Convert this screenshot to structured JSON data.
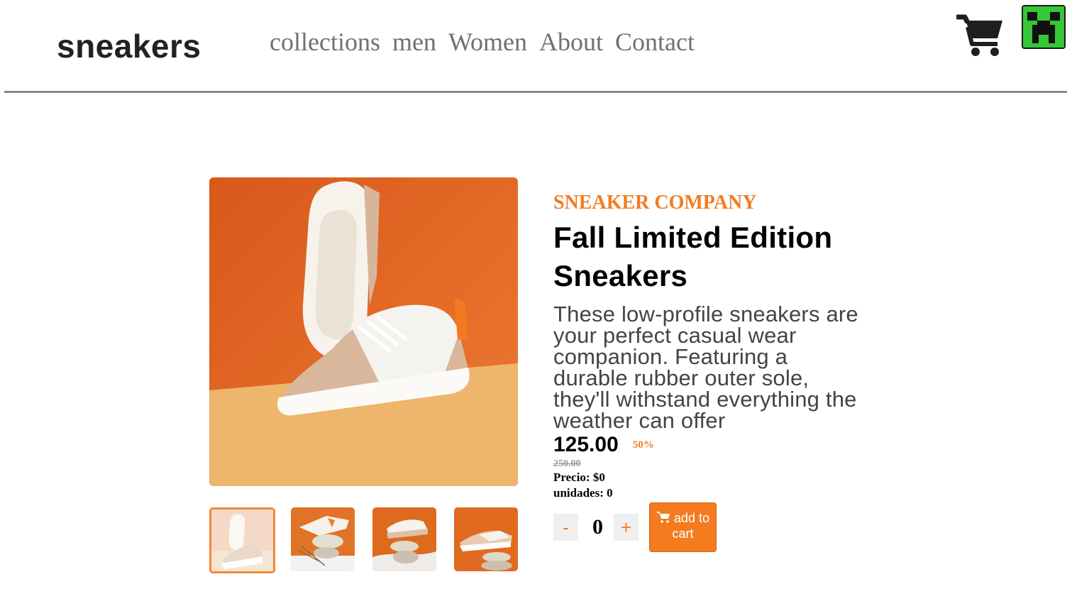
{
  "header": {
    "logo": "sneakers",
    "nav": [
      "collections",
      "men",
      "Women",
      "About",
      "Contact"
    ],
    "cart_icon": "shopping-cart-icon",
    "avatar_icon": "creeper-avatar"
  },
  "product": {
    "company": "SNEAKER COMPANY",
    "title": "Fall Limited Edition Sneakers",
    "description": "These low-profile sneakers are your perfect casual wear companion. Featuring a durable rubber outer sole, they'll withstand everything the weather can offer",
    "price": "125.00",
    "discount": "50%",
    "original_price": "250.00",
    "precio": "Precio: $0",
    "unidades": "unidades: 0"
  },
  "cart_controls": {
    "minus": "-",
    "quantity": "0",
    "plus": "+",
    "add_label": "add to cart"
  },
  "gallery": {
    "thumbnails": [
      "thumbnail-1",
      "thumbnail-2",
      "thumbnail-3",
      "thumbnail-4"
    ],
    "active_index": 0
  },
  "colors": {
    "accent": "#f47b20",
    "avatar_green": "#33cc33"
  }
}
